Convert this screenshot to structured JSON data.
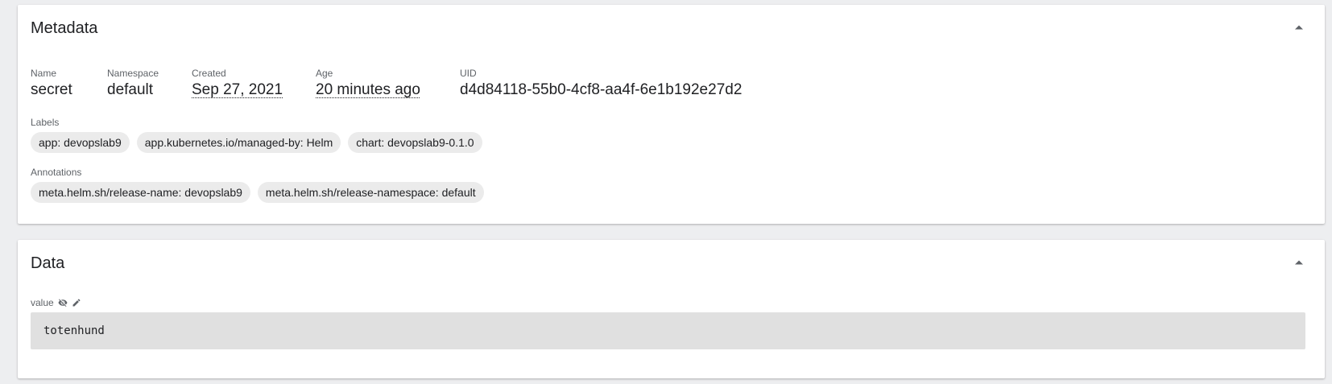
{
  "metadata": {
    "title": "Metadata",
    "fields": {
      "name": {
        "label": "Name",
        "value": "secret"
      },
      "namespace": {
        "label": "Namespace",
        "value": "default"
      },
      "created": {
        "label": "Created",
        "value": "Sep 27, 2021"
      },
      "age": {
        "label": "Age",
        "value": "20 minutes ago"
      },
      "uid": {
        "label": "UID",
        "value": "d4d84118-55b0-4cf8-aa4f-6e1b192e27d2"
      }
    },
    "labels": {
      "title": "Labels",
      "items": [
        "app: devopslab9",
        "app.kubernetes.io/managed-by: Helm",
        "chart: devopslab9-0.1.0"
      ]
    },
    "annotations": {
      "title": "Annotations",
      "items": [
        "meta.helm.sh/release-name: devopslab9",
        "meta.helm.sh/release-namespace: default"
      ]
    }
  },
  "data": {
    "title": "Data",
    "entries": [
      {
        "key": "value",
        "value": "totenhund"
      }
    ]
  },
  "icons": {
    "collapse": "chevron-up-icon",
    "hide": "eye-off-icon",
    "edit": "pencil-icon"
  }
}
